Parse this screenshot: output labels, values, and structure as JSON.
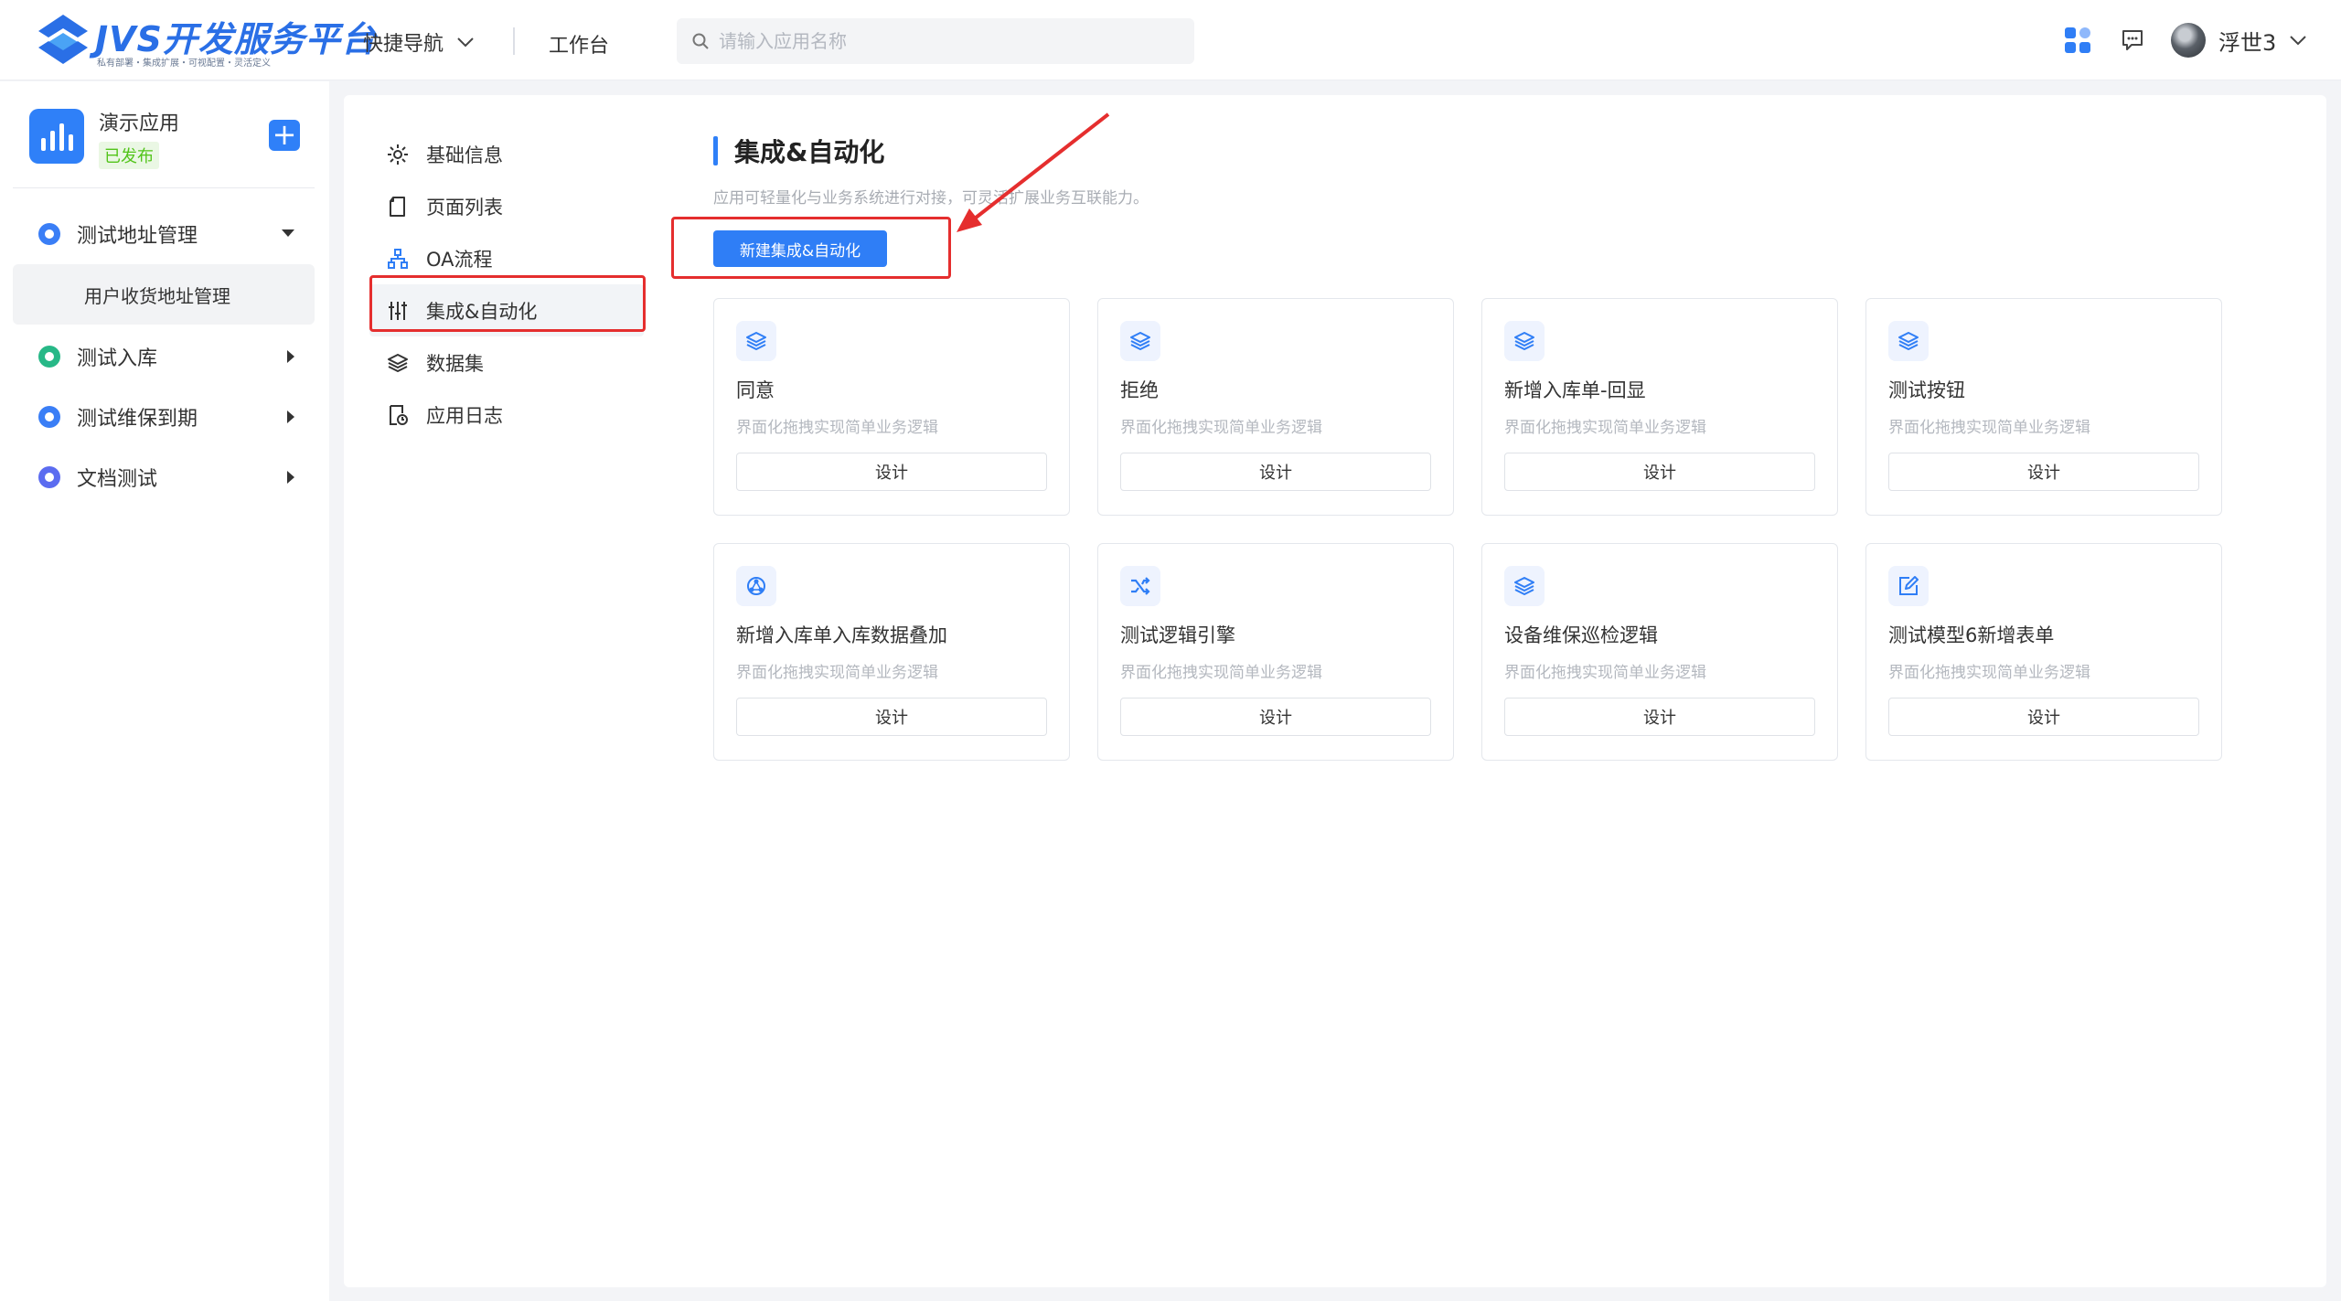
{
  "header": {
    "logo_title": "JVS开发服务平台",
    "logo_subtitle": "私有部署・集成扩展・可视配置・灵活定义",
    "quick_nav_label": "快捷导航",
    "workbench_label": "工作台",
    "search_placeholder": "请输入应用名称",
    "user_name": "浮世3"
  },
  "sidebar": {
    "app_name": "演示应用",
    "app_status": "已发布",
    "menu": [
      {
        "label": "测试地址管理",
        "color": "#3a7ef6"
      },
      {
        "label": "测试入库",
        "color": "#27b887"
      },
      {
        "label": "测试维保到期",
        "color": "#3a7ef6"
      },
      {
        "label": "文档测试",
        "color": "#5b6cf0"
      }
    ],
    "submenu_label": "用户收货地址管理"
  },
  "settings_nav": [
    {
      "label": "基础信息",
      "icon": "gear-icon"
    },
    {
      "label": "页面列表",
      "icon": "page-icon"
    },
    {
      "label": "OA流程",
      "icon": "flow-icon"
    },
    {
      "label": "集成&自动化",
      "icon": "sliders-icon"
    },
    {
      "label": "数据集",
      "icon": "layers-icon"
    },
    {
      "label": "应用日志",
      "icon": "log-icon"
    }
  ],
  "section": {
    "title": "集成&自动化",
    "description": "应用可轻量化与业务系统进行对接，可灵活扩展业务互联能力。",
    "new_button": "新建集成&自动化"
  },
  "cards": [
    {
      "title": "同意",
      "desc": "界面化拖拽实现简单业务逻辑",
      "button": "设计",
      "icon": "layers-icon"
    },
    {
      "title": "拒绝",
      "desc": "界面化拖拽实现简单业务逻辑",
      "button": "设计",
      "icon": "layers-icon"
    },
    {
      "title": "新增入库单-回显",
      "desc": "界面化拖拽实现简单业务逻辑",
      "button": "设计",
      "icon": "layers-icon"
    },
    {
      "title": "测试按钮",
      "desc": "界面化拖拽实现简单业务逻辑",
      "button": "设计",
      "icon": "layers-icon"
    },
    {
      "title": "新增入库单入库数据叠加",
      "desc": "界面化拖拽实现简单业务逻辑",
      "button": "设计",
      "icon": "network-icon"
    },
    {
      "title": "测试逻辑引擎",
      "desc": "界面化拖拽实现简单业务逻辑",
      "button": "设计",
      "icon": "shuffle-icon"
    },
    {
      "title": "设备维保巡检逻辑",
      "desc": "界面化拖拽实现简单业务逻辑",
      "button": "设计",
      "icon": "layers-icon"
    },
    {
      "title": "测试模型6新增表单",
      "desc": "界面化拖拽实现简单业务逻辑",
      "button": "设计",
      "icon": "edit-icon"
    }
  ],
  "colors": {
    "primary": "#2f7ef6",
    "annotation": "#e52e2e",
    "published": "#52c41a"
  }
}
